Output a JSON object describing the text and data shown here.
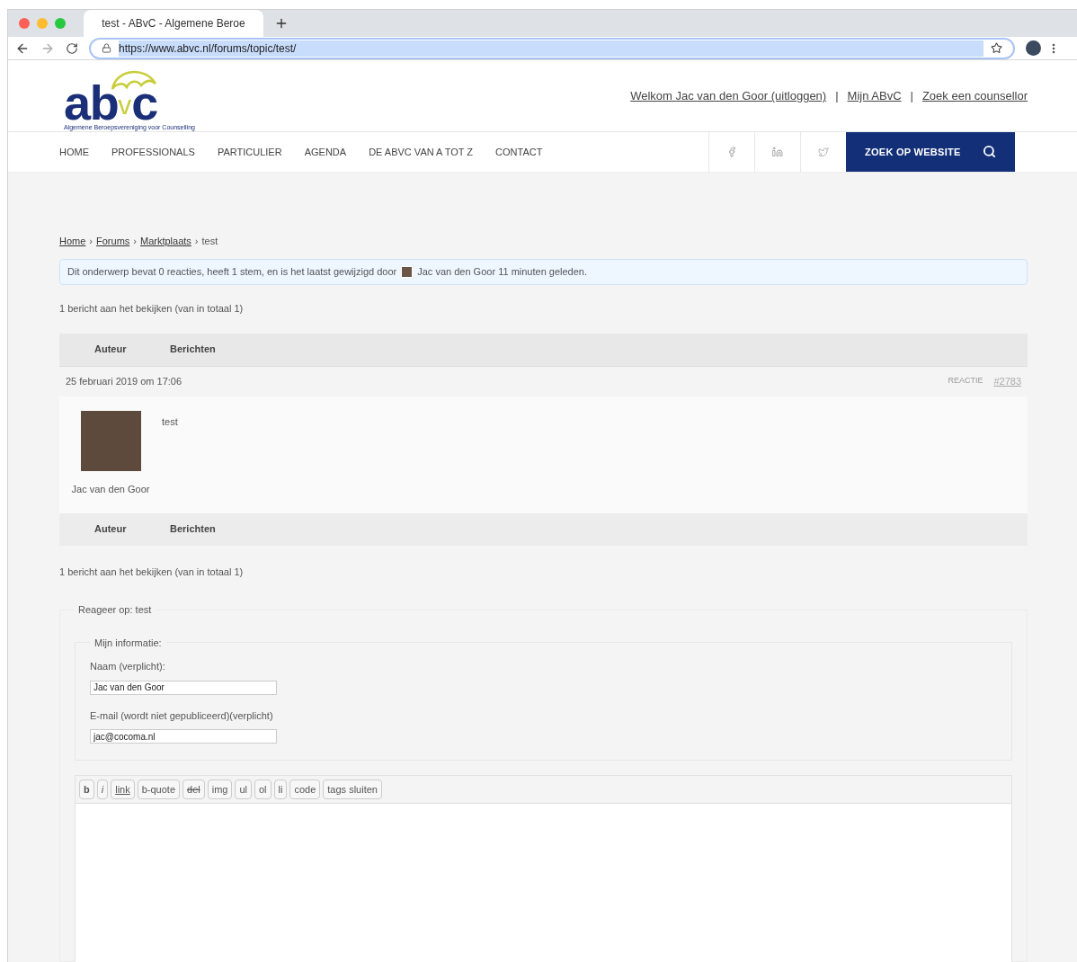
{
  "browser": {
    "tab_title": "test - ABvC - Algemene Beroe",
    "url": "https://www.abvc.nl/forums/topic/test/"
  },
  "header": {
    "logo": {
      "letters_left": "ab",
      "letter_middle": "v",
      "letters_right": "c",
      "tagline": "Algemene Beroepsvereniging voor Counselling"
    },
    "top_links": [
      {
        "text": "Welkom Jac van den Goor (uitloggen)"
      },
      {
        "text": "Mijn ABvC"
      },
      {
        "text": "Zoek een counsellor"
      }
    ],
    "separator": "|"
  },
  "nav": {
    "items": [
      "HOME",
      "PROFESSIONALS",
      "PARTICULIER",
      "AGENDA",
      "DE ABVC VAN A TOT Z",
      "CONTACT"
    ],
    "search_button": "ZOEK OP WEBSITE"
  },
  "breadcrumb": [
    {
      "text": "Home",
      "link": true
    },
    {
      "text": "Forums",
      "link": true
    },
    {
      "text": "Marktplaats",
      "link": true
    },
    {
      "text": "test",
      "link": false
    }
  ],
  "breadcrumb_separator": "›",
  "notice": {
    "before": "Dit onderwerp bevat 0 reacties, heeft 1 stem, en is het laatst gewijzigd door",
    "author": "Jac van den Goor",
    "after": "11 minuten geleden."
  },
  "count_top": "1 bericht aan het bekijken (van in totaal 1)",
  "table": {
    "columns": [
      "Auteur",
      "Berichten"
    ],
    "post": {
      "date": "25 februari 2019 om 17:06",
      "reply_label": "REACTIE",
      "reply_id": "#2783",
      "author": "Jac van den Goor",
      "content": "test"
    },
    "footer_columns": [
      "Auteur",
      "Berichten"
    ]
  },
  "count_bottom": "1 bericht aan het bekijken (van in totaal 1)",
  "reply_form": {
    "legend": "Reageer op: test",
    "info_legend": "Mijn informatie:",
    "fields": [
      {
        "label": "Naam (verplicht):",
        "value": "Jac van den Goor"
      },
      {
        "label": "E-mail (wordt niet gepubliceerd)(verplicht)",
        "value": "jac@cocoma.nl"
      }
    ],
    "toolbar": [
      {
        "label": "b",
        "kind": "bold"
      },
      {
        "label": "i",
        "kind": "italic"
      },
      {
        "label": "link",
        "kind": "underline"
      },
      {
        "label": "b-quote",
        "kind": "plain"
      },
      {
        "label": "del",
        "kind": "strike"
      },
      {
        "label": "img",
        "kind": "plain"
      },
      {
        "label": "ul",
        "kind": "plain"
      },
      {
        "label": "ol",
        "kind": "plain"
      },
      {
        "label": "li",
        "kind": "plain"
      },
      {
        "label": "code",
        "kind": "plain"
      },
      {
        "label": "tags sluiten",
        "kind": "plain"
      }
    ]
  }
}
